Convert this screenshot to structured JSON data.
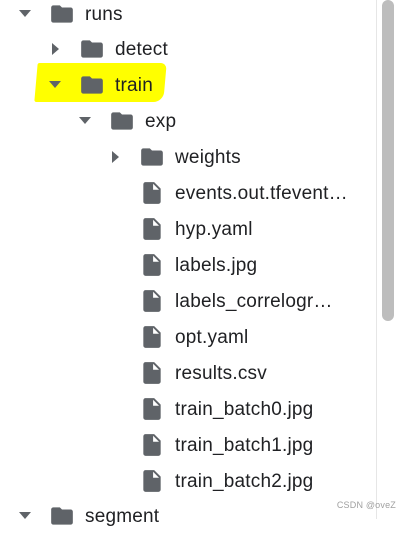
{
  "tree": {
    "items": [
      {
        "label": "runs",
        "type": "folder",
        "expanded": true
      },
      {
        "label": "detect",
        "type": "folder",
        "expanded": false
      },
      {
        "label": "train",
        "type": "folder",
        "expanded": true,
        "highlighted": true
      },
      {
        "label": "exp",
        "type": "folder",
        "expanded": true
      },
      {
        "label": "weights",
        "type": "folder",
        "expanded": false
      },
      {
        "label": "events.out.tfevent…",
        "type": "file"
      },
      {
        "label": "hyp.yaml",
        "type": "file"
      },
      {
        "label": "labels.jpg",
        "type": "file"
      },
      {
        "label": "labels_correlogr…",
        "type": "file"
      },
      {
        "label": "opt.yaml",
        "type": "file"
      },
      {
        "label": "results.csv",
        "type": "file"
      },
      {
        "label": "train_batch0.jpg",
        "type": "file"
      },
      {
        "label": "train_batch1.jpg",
        "type": "file"
      },
      {
        "label": "train_batch2.jpg",
        "type": "file"
      },
      {
        "label": "segment",
        "type": "folder",
        "expanded": true
      }
    ]
  },
  "icons": {
    "folder": "folder-icon",
    "file": "file-icon",
    "expanded": "chevron-down-icon",
    "collapsed": "chevron-right-icon"
  },
  "colors": {
    "icon": "#5f6368",
    "text": "#202124",
    "highlight": "#ffff00",
    "scroll_thumb": "#bdbdbd"
  },
  "watermark": {
    "text": "CSDN @oveZ"
  }
}
